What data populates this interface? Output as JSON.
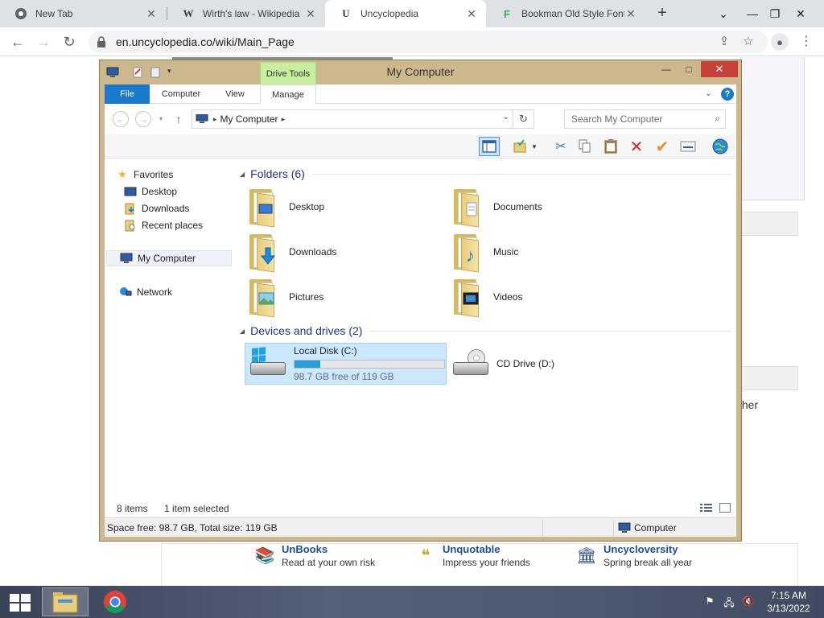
{
  "browser": {
    "tabs": [
      {
        "title": "New Tab",
        "icon": "chrome-icon"
      },
      {
        "title": "Wirth's law - Wikipedia",
        "icon": "wikipedia-icon"
      },
      {
        "title": "Uncyclopedia",
        "icon": "uncyclopedia-icon"
      },
      {
        "title": "Bookman Old Style Font",
        "icon": "fontspace-icon"
      }
    ],
    "active_tab_index": 2,
    "url": "en.uncyclopedia.co/wiki/Main_Page"
  },
  "wiki_page": {
    "partial_text": "ther",
    "projects": [
      {
        "title": "UnBooks",
        "subtitle": "Read at your own risk"
      },
      {
        "title": "Unquotable",
        "subtitle": "Impress your friends"
      },
      {
        "title": "Uncycloversity",
        "subtitle": "Spring break all year"
      }
    ]
  },
  "explorer": {
    "title": "My Computer",
    "contextual_tab_group": "Drive Tools",
    "ribbon_tabs": {
      "file": "File",
      "computer": "Computer",
      "view": "View",
      "manage": "Manage"
    },
    "address": {
      "crumb": "My Computer"
    },
    "search_placeholder": "Search My Computer",
    "nav": {
      "favorites": "Favorites",
      "desktop": "Desktop",
      "downloads": "Downloads",
      "recent": "Recent places",
      "computer": "My Computer",
      "network": "Network"
    },
    "folders_header": "Folders (6)",
    "folders": [
      {
        "name": "Desktop",
        "icon": "desktop-folder-icon"
      },
      {
        "name": "Documents",
        "icon": "documents-folder-icon"
      },
      {
        "name": "Downloads",
        "icon": "downloads-folder-icon"
      },
      {
        "name": "Music",
        "icon": "music-folder-icon"
      },
      {
        "name": "Pictures",
        "icon": "pictures-folder-icon"
      },
      {
        "name": "Videos",
        "icon": "videos-folder-icon"
      }
    ],
    "devices_header": "Devices and drives (2)",
    "drives": [
      {
        "name": "Local Disk (C:)",
        "free_text": "98.7 GB free of 119 GB",
        "used_fraction": 0.17,
        "selected": true
      },
      {
        "name": "CD Drive (D:)"
      }
    ],
    "status": {
      "items": "8 items",
      "selected": "1 item selected"
    },
    "details": {
      "space": "Space free: 98.7 GB, Total size: 119 GB",
      "location": "Computer"
    }
  },
  "taskbar": {
    "time": "7:15 AM",
    "date": "3/13/2022"
  },
  "colors": {
    "window_frame": "#cdb88e",
    "file_tab": "#1979ca",
    "drive_tools": "#c8eea0",
    "close_button": "#c7403a",
    "selection": "#cce8ff",
    "drive_bar": "#26a0da"
  }
}
